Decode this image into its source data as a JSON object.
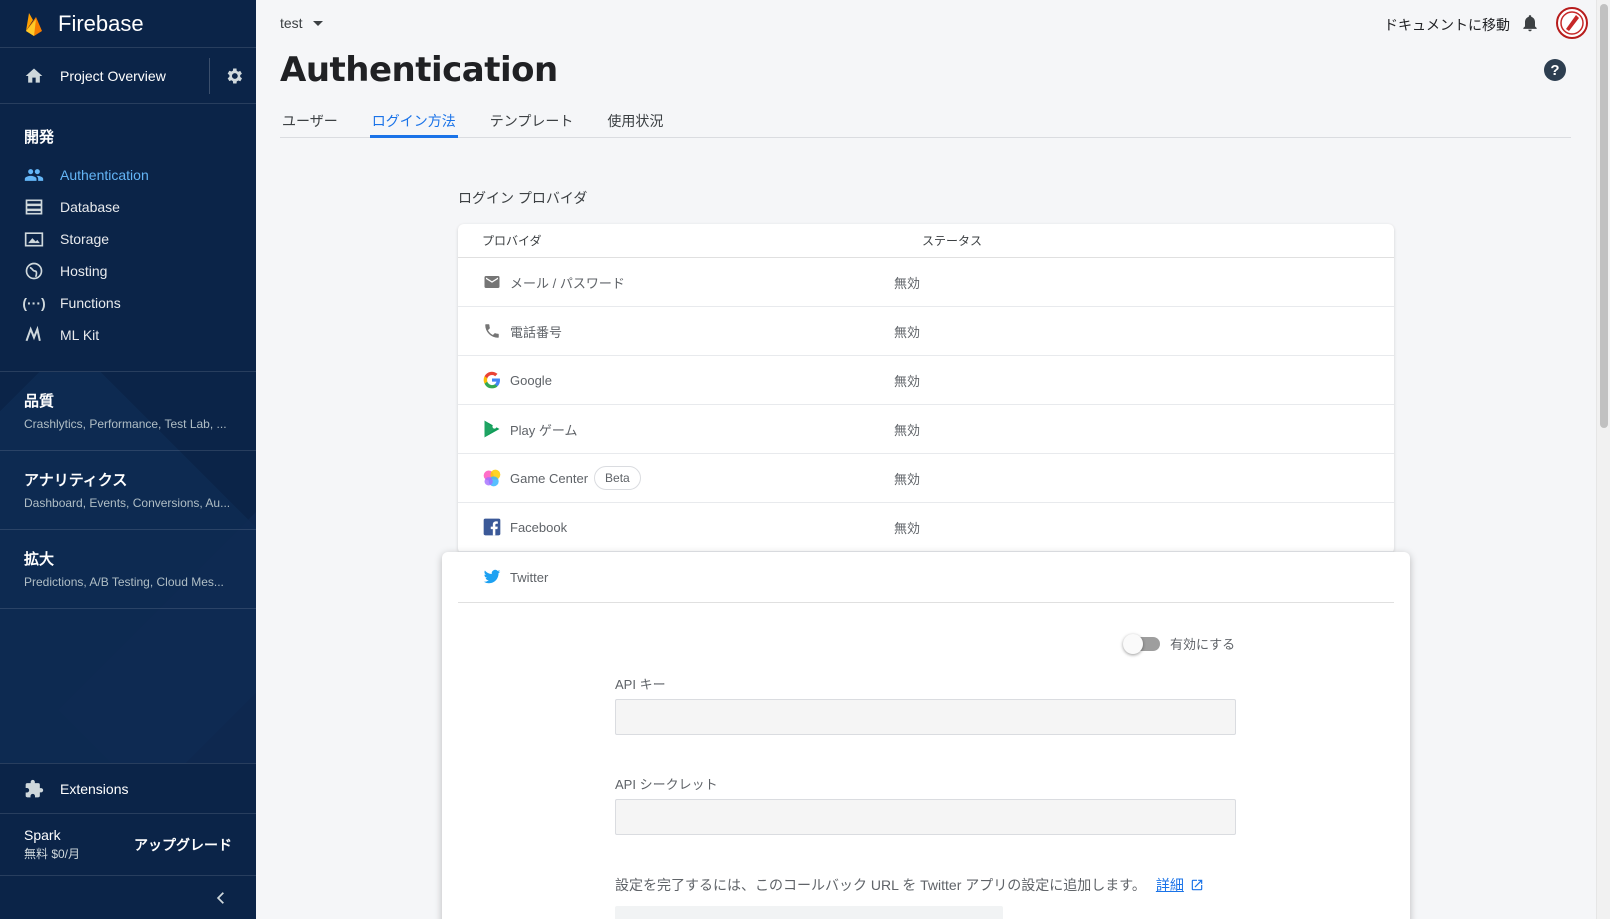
{
  "sidebar": {
    "brand": "Firebase",
    "overview_label": "Project Overview",
    "dev_section": "開発",
    "dev_items": [
      {
        "label": "Authentication",
        "icon": "people-icon",
        "active": true
      },
      {
        "label": "Database",
        "icon": "database-icon"
      },
      {
        "label": "Storage",
        "icon": "storage-icon"
      },
      {
        "label": "Hosting",
        "icon": "hosting-icon"
      },
      {
        "label": "Functions",
        "icon": "functions-icon"
      },
      {
        "label": "ML Kit",
        "icon": "mlkit-icon"
      }
    ],
    "groups": [
      {
        "title": "品質",
        "subtitle": "Crashlytics, Performance, Test Lab, ..."
      },
      {
        "title": "アナリティクス",
        "subtitle": "Dashboard, Events, Conversions, Au..."
      },
      {
        "title": "拡大",
        "subtitle": "Predictions, A/B Testing, Cloud Mes..."
      }
    ],
    "extensions_label": "Extensions",
    "plan_name": "Spark",
    "plan_price": "無料 $0/月",
    "upgrade_label": "アップグレード"
  },
  "header": {
    "project_name": "test",
    "docs_link": "ドキュメントに移動",
    "page_title": "Authentication",
    "help": "?"
  },
  "tabs": [
    {
      "label": "ユーザー",
      "active": false
    },
    {
      "label": "ログイン方法",
      "active": true
    },
    {
      "label": "テンプレート",
      "active": false
    },
    {
      "label": "使用状況",
      "active": false
    }
  ],
  "providers": {
    "section_title": "ログイン プロバイダ",
    "col_provider": "プロバイダ",
    "col_status": "ステータス",
    "rows": [
      {
        "name": "メール / パスワード",
        "status": "無効",
        "icon": "email-icon"
      },
      {
        "name": "電話番号",
        "status": "無効",
        "icon": "phone-icon"
      },
      {
        "name": "Google",
        "status": "無効",
        "icon": "google-icon"
      },
      {
        "name": "Play ゲーム",
        "status": "無効",
        "icon": "play-games-icon"
      },
      {
        "name": "Game Center",
        "status": "無効",
        "icon": "game-center-icon",
        "badge": "Beta"
      },
      {
        "name": "Facebook",
        "status": "無効",
        "icon": "facebook-icon"
      }
    ]
  },
  "twitter_panel": {
    "name": "Twitter",
    "enable_label": "有効にする",
    "api_key_label": "API キー",
    "api_key_value": "",
    "api_secret_label": "API シークレット",
    "api_secret_value": "",
    "callback_text": "設定を完了するには、このコールバック URL を Twitter アプリの設定に追加します。",
    "details_link": "詳細"
  },
  "colors": {
    "sidebar_bg": "#0b2448",
    "accent": "#1a73e8",
    "active_nav": "#64b5f6"
  }
}
